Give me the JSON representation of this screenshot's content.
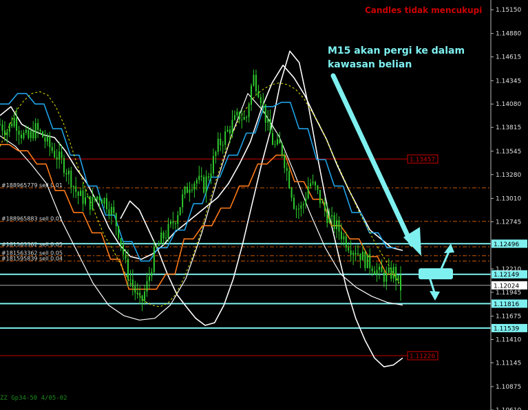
{
  "header": {
    "warning": "Candles tidak mencukupi"
  },
  "note": {
    "line1": "M15 akan pergi ke dalam",
    "line2": "kawasan belian"
  },
  "footer": {
    "text": "ZZ Gp34-50 4/05-02"
  },
  "colors": {
    "background": "#000000",
    "candle": "#2ecc2e",
    "channel": "#ffffff",
    "step_blue": "#1fa3e8",
    "step_orange": "#ff7a1a",
    "dashed_yellow": "#e6e600",
    "cyan_level": "#7ff0f0",
    "red_level": "#cc0000"
  },
  "chart_data": {
    "type": "line",
    "title": "",
    "xlabel": "",
    "ylabel": "",
    "ylim": [
      1.1061,
      1.1526
    ],
    "y_ticks": [
      "1.15150",
      "1.14880",
      "1.14615",
      "1.14345",
      "1.14080",
      "1.13815",
      "1.13545",
      "1.13280",
      "1.13010",
      "1.12745",
      "1.12210",
      "1.11945",
      "1.11675",
      "1.11410",
      "1.11145",
      "1.10875",
      "1.10610"
    ],
    "levels": [
      {
        "price": 1.12496,
        "label": "1.12496",
        "kind": "cyan"
      },
      {
        "price": 1.12149,
        "label": "1.12149",
        "kind": "cyan"
      },
      {
        "price": 1.11816,
        "label": "1.11816",
        "kind": "cyan"
      },
      {
        "price": 1.11539,
        "label": "1.11539",
        "kind": "cyan"
      },
      {
        "price": 1.12024,
        "label": "1.12024",
        "kind": "current"
      },
      {
        "price": 1.13457,
        "label": "1.13457",
        "kind": "red"
      },
      {
        "price": 1.11226,
        "label": "1.11226",
        "kind": "red"
      }
    ],
    "orders": [
      {
        "price": 1.1313,
        "label": "#188965779 sell 0.01"
      },
      {
        "price": 1.1275,
        "label": "#188965883 sell 0.01"
      },
      {
        "price": 1.1246,
        "label": "#181563362 sell 0.05"
      },
      {
        "price": 1.1236,
        "label": "#181563362 sell 0.05"
      },
      {
        "price": 1.123,
        "label": "#181595839 sell 0.04"
      }
    ],
    "series": [
      {
        "values": [
          1.1385,
          1.1378,
          1.1392,
          1.1375,
          1.1368,
          1.138,
          1.1372,
          1.136,
          1.135,
          1.134,
          1.1325,
          1.1305,
          1.13,
          1.1295,
          1.1305,
          1.1298,
          1.1285,
          1.126,
          1.122,
          1.12,
          1.118,
          1.1205,
          1.124,
          1.1255,
          1.1265,
          1.128,
          1.1302,
          1.1318,
          1.1322,
          1.1315,
          1.1335,
          1.136,
          1.1372,
          1.1385,
          1.1395,
          1.139,
          1.144,
          1.142,
          1.1385,
          1.136,
          1.136,
          1.1325,
          1.129,
          1.129,
          1.132,
          1.131,
          1.129,
          1.1275,
          1.1268,
          1.1255,
          1.1245,
          1.124,
          1.123,
          1.1225,
          1.1215,
          1.1212,
          1.1218,
          1.12
        ]
      },
      {
        "values": [
          1.1395,
          1.1405,
          1.1385,
          1.1378,
          1.1373,
          1.137,
          1.1355,
          1.1335,
          1.1318,
          1.1295,
          1.1268,
          1.1248,
          1.1235,
          1.1232,
          1.1238,
          1.1248,
          1.1262,
          1.1272,
          1.1282,
          1.1292,
          1.1302,
          1.1318,
          1.134,
          1.1365,
          1.1402,
          1.1432,
          1.1452,
          1.1438,
          1.1418,
          1.1392,
          1.1368,
          1.1338,
          1.1312,
          1.1288,
          1.1265,
          1.1255,
          1.1245,
          1.1242
        ]
      },
      {
        "values": [
          1.1278,
          1.1298,
          1.1288,
          1.1265,
          1.1242,
          1.1215,
          1.1192,
          1.1178,
          1.1165,
          1.1157,
          1.116,
          1.118,
          1.121,
          1.125,
          1.1295,
          1.134,
          1.138,
          1.1432,
          1.1468,
          1.1455,
          1.1405,
          1.1345,
          1.129,
          1.1245,
          1.12,
          1.1165,
          1.114,
          1.112,
          1.111,
          1.1112,
          1.112
        ]
      },
      {
        "values": [
          1.1372,
          1.136,
          1.134,
          1.1318,
          1.1275,
          1.124,
          1.1205,
          1.118,
          1.1168,
          1.1163,
          1.1165,
          1.118,
          1.121,
          1.126,
          1.132,
          1.1375,
          1.142,
          1.14,
          1.1372,
          1.133,
          1.1285,
          1.1245,
          1.1215,
          1.12,
          1.119,
          1.1183,
          1.118
        ]
      },
      {
        "values": [
          1.1408,
          1.1408,
          1.142,
          1.142,
          1.1408,
          1.1408,
          1.138,
          1.138,
          1.135,
          1.135,
          1.1315,
          1.1315,
          1.1282,
          1.1282,
          1.1252,
          1.1252,
          1.123,
          1.123,
          1.1245,
          1.1245,
          1.1265,
          1.1265,
          1.1295,
          1.1295,
          1.1325,
          1.1325,
          1.135,
          1.135,
          1.1375,
          1.1375,
          1.1405,
          1.1405,
          1.141,
          1.141,
          1.138,
          1.138,
          1.1345,
          1.1345,
          1.1315,
          1.1315,
          1.1285,
          1.1285,
          1.1262,
          1.1262,
          1.1245,
          1.1245
        ]
      },
      {
        "values": [
          1.1362,
          1.1362,
          1.1355,
          1.1355,
          1.134,
          1.134,
          1.131,
          1.131,
          1.1285,
          1.1285,
          1.1262,
          1.1262,
          1.1232,
          1.1232,
          1.1198,
          1.1198,
          1.1198,
          1.1198,
          1.1215,
          1.1215,
          1.1255,
          1.1255,
          1.127,
          1.127,
          1.129,
          1.129,
          1.1315,
          1.1315,
          1.134,
          1.134,
          1.135,
          1.135,
          1.132,
          1.132,
          1.13,
          1.13,
          1.127,
          1.127,
          1.1255,
          1.1255,
          1.1235,
          1.1235,
          1.1215,
          1.1215
        ]
      },
      {
        "values": [
          1.136,
          1.138,
          1.14,
          1.1412,
          1.142,
          1.1422,
          1.1418,
          1.1405,
          1.1385,
          1.1358,
          1.133,
          1.1305,
          1.1282,
          1.126,
          1.1245,
          1.1228,
          1.121,
          1.1195,
          1.1185,
          1.118,
          1.1178,
          1.1182,
          1.1192,
          1.121,
          1.1232,
          1.1258,
          1.129,
          1.132,
          1.1348,
          1.1372,
          1.1392,
          1.1405,
          1.1418,
          1.1425,
          1.143,
          1.1432,
          1.143,
          1.1425,
          1.1415,
          1.14,
          1.1385,
          1.1365,
          1.1345,
          1.1325,
          1.1305,
          1.1285,
          1.1268,
          1.125,
          1.1235,
          1.122,
          1.1205
        ]
      }
    ]
  }
}
